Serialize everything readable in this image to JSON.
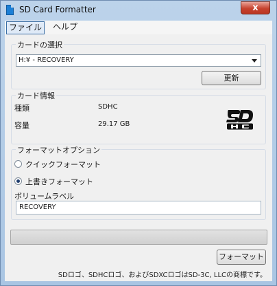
{
  "window": {
    "title": "SD Card Formatter",
    "close_label": "x"
  },
  "menu": {
    "file": "ファイル",
    "help": "ヘルプ"
  },
  "card_select": {
    "label": "カードの選択",
    "selected": "H:¥ - RECOVERY",
    "refresh_button": "更新"
  },
  "card_info": {
    "label": "カード情報",
    "type_key": "種類",
    "type_value": "SDHC",
    "capacity_key": "容量",
    "capacity_value": "29.17 GB"
  },
  "format_options": {
    "label": "フォーマットオプション",
    "quick_format": "クイックフォーマット",
    "overwrite_format": "上書きフォーマット",
    "selected_option": "overwrite",
    "volume_label_title": "ボリュームラベル",
    "volume_label_value": "RECOVERY"
  },
  "progress": {
    "value": 0
  },
  "actions": {
    "format_button": "フォーマット"
  },
  "footer": {
    "trademark": "SDロゴ、SDHCロゴ、およびSDXCロゴはSD-3C, LLCの商標です。"
  },
  "colors": {
    "titlebar": "#bcd3ea",
    "close_button": "#c7432f",
    "progress_fill": "#2db52d"
  }
}
